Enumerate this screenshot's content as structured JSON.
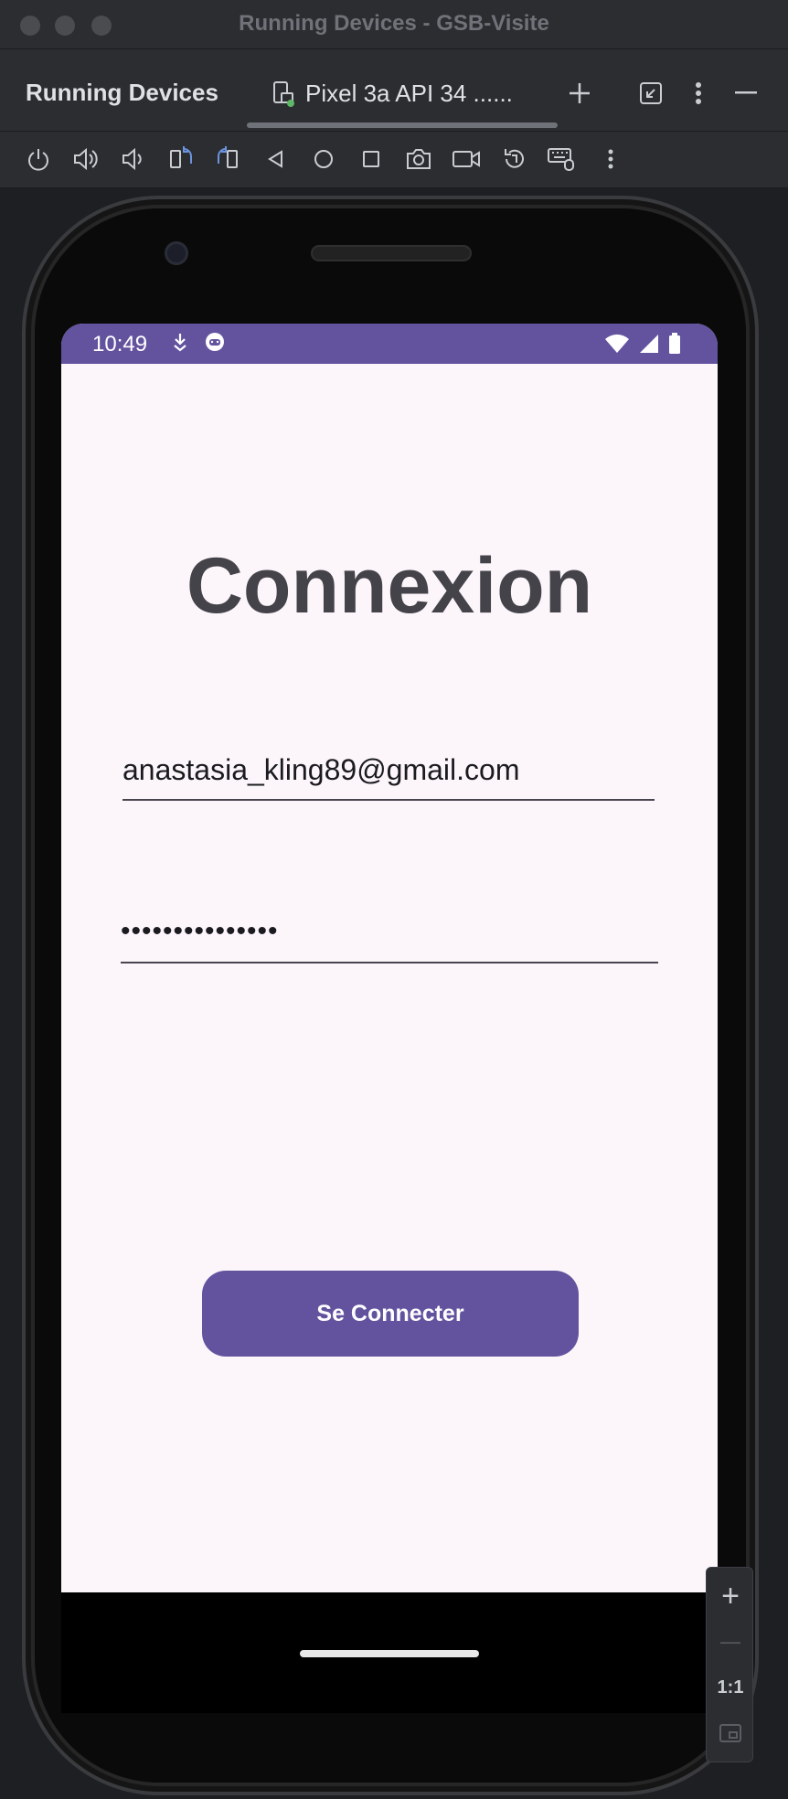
{
  "window": {
    "title": "Running Devices - GSB-Visite"
  },
  "tabbar": {
    "tool_title": "Running Devices",
    "device_tab_label": "Pixel 3a API 34 ......"
  },
  "toolbar": {
    "icons": [
      "power-icon",
      "volume-up-icon",
      "volume-down-icon",
      "rotate-left-icon",
      "rotate-right-icon",
      "back-icon",
      "home-icon",
      "overview-icon",
      "screenshot-icon",
      "screen-record-icon",
      "reset-icon",
      "keyboard-mouse-icon",
      "more-icon"
    ]
  },
  "phone": {
    "status": {
      "time": "10:49"
    },
    "screen": {
      "heading": "Connexion",
      "email_value": "anastasia_kling89@gmail.com",
      "password_value": "•••••••••••••••",
      "button_label": "Se Connecter"
    }
  },
  "zoom": {
    "plus": "+",
    "minus": "—",
    "one_to_one": "1:1"
  },
  "colors": {
    "accent": "#63539f",
    "screen_bg": "#fcf6fb",
    "ide_bg": "#2b2d30"
  }
}
